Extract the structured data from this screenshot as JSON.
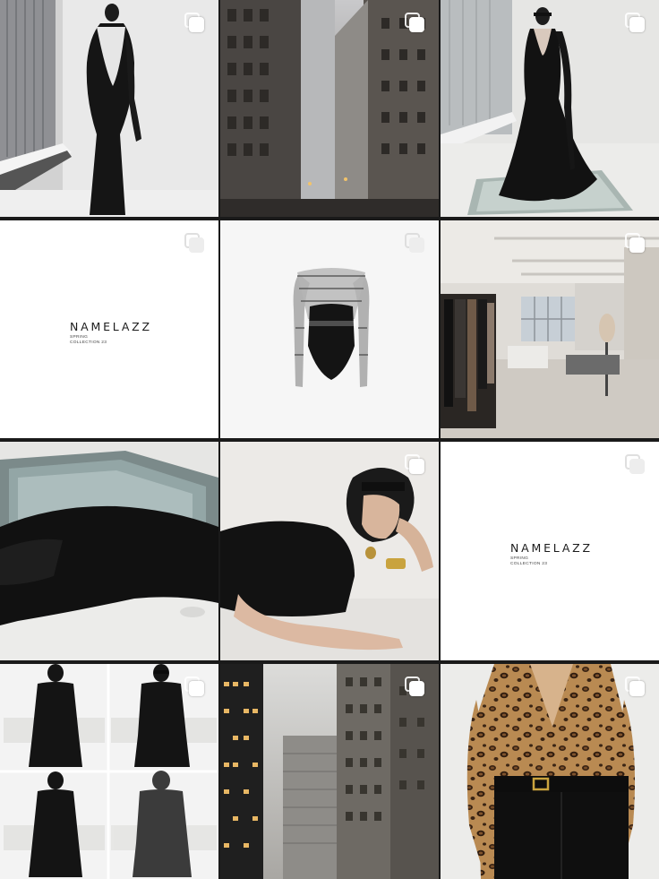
{
  "feed": {
    "posts": [
      {
        "subject": "model-black-open-back-dress",
        "multi": true
      },
      {
        "subject": "foggy-city-street",
        "multi": true
      },
      {
        "subject": "model-black-gown-glass-floor",
        "multi": true
      },
      {
        "subject": "brand-card",
        "multi": true,
        "brand": "NAMELAZZ",
        "line1": "SPRING",
        "line2": "COLLECTION 23"
      },
      {
        "subject": "sheer-bodysuit",
        "multi": true
      },
      {
        "subject": "design-studio-interior",
        "multi": true
      },
      {
        "subject": "model-reclining-black-gown",
        "multi": false
      },
      {
        "subject": "model-reclining-halter-top",
        "multi": true
      },
      {
        "subject": "brand-card",
        "multi": true,
        "brand": "NAMELAZZ",
        "line1": "SPRING",
        "line2": "COLLECTION 23"
      },
      {
        "subject": "model-black-suit-collage",
        "multi": true
      },
      {
        "subject": "skyscrapers-in-fog",
        "multi": true
      },
      {
        "subject": "leopard-print-blouse",
        "multi": true
      }
    ]
  },
  "icons": {
    "carousel": "multiple-photos-icon"
  },
  "colors": {
    "background": "#ffffff",
    "gutter": "#1a1a1a",
    "icon": "#ffffff"
  }
}
